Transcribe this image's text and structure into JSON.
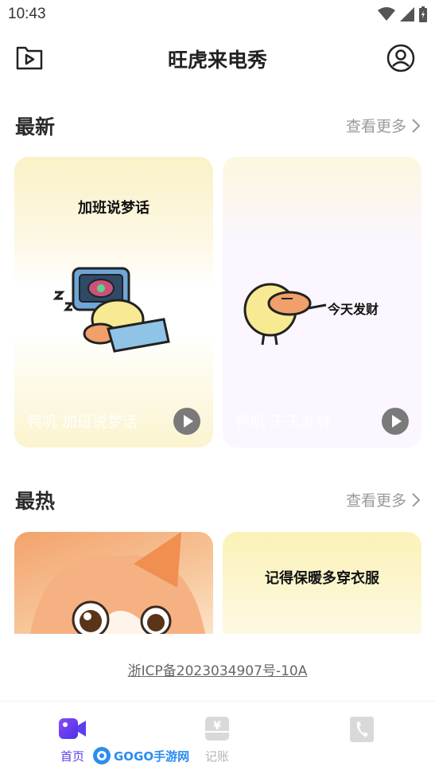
{
  "status_bar": {
    "time": "10:43"
  },
  "header": {
    "title": "旺虎来电秀"
  },
  "sections": {
    "latest": {
      "title": "最新",
      "more": "查看更多",
      "cards": [
        {
          "sticker_text": "加班说梦话",
          "caption": "鸭叽 加班说梦话"
        },
        {
          "sticker_text": "今天发财",
          "caption": "鸭叽 天天发财"
        }
      ]
    },
    "hot": {
      "title": "最热",
      "more": "查看更多",
      "cards": [
        {
          "sticker_text": ""
        },
        {
          "sticker_text": "记得保暖多穿衣服"
        }
      ]
    }
  },
  "footer": {
    "icp": "浙ICP备2023034907号-10A"
  },
  "tabs": [
    {
      "label": "首页",
      "active": true,
      "color": "#5b3ff0"
    },
    {
      "label": "记账",
      "active": false
    },
    {
      "label": "",
      "active": false
    }
  ],
  "watermark": "GOGO手游网",
  "colors": {
    "accent": "#5b3ff0",
    "muted": "#9a9a9a"
  }
}
